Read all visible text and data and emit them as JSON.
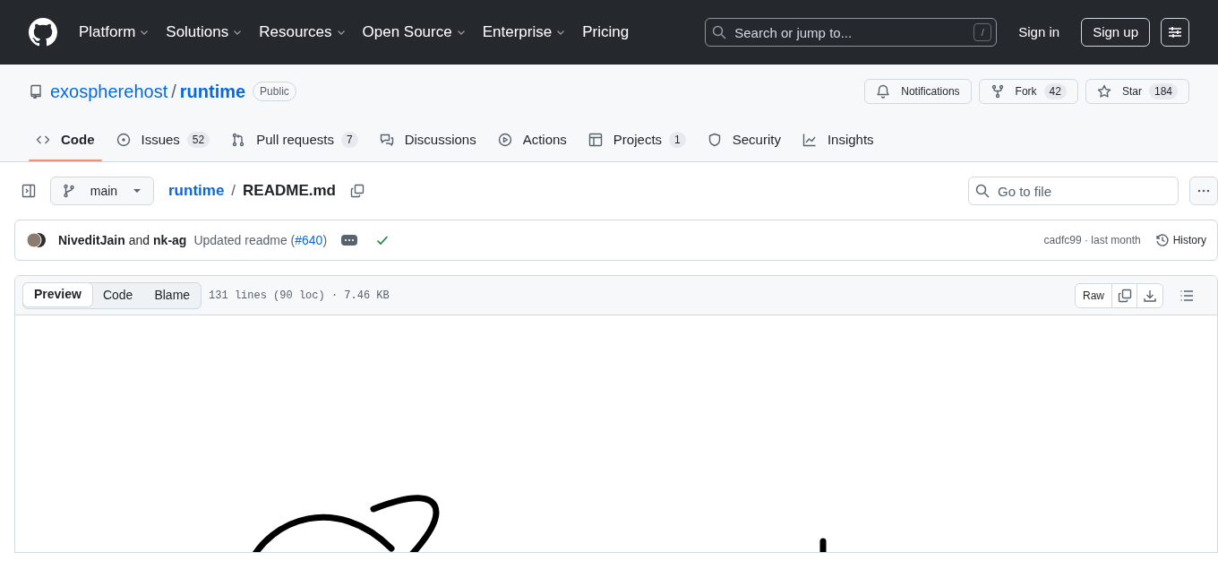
{
  "header": {
    "nav": [
      "Platform",
      "Solutions",
      "Resources",
      "Open Source",
      "Enterprise",
      "Pricing"
    ],
    "search": {
      "placeholder": "Search or jump to...",
      "key": "/"
    },
    "sign_in": "Sign in",
    "sign_up": "Sign up"
  },
  "repo": {
    "owner": "exospherehost",
    "separator": "/",
    "name": "runtime",
    "visibility": "Public",
    "actions": [
      {
        "kind": "notifications",
        "label": "Notifications"
      },
      {
        "kind": "fork",
        "label": "Fork",
        "count": "42"
      },
      {
        "kind": "star",
        "label": "Star",
        "count": "184"
      }
    ]
  },
  "tabs": [
    {
      "kind": "code",
      "label": "Code",
      "selected": true
    },
    {
      "kind": "issues",
      "label": "Issues",
      "count": "52",
      "selected": false
    },
    {
      "kind": "pulls",
      "label": "Pull requests",
      "count": "7",
      "selected": false
    },
    {
      "kind": "discussions",
      "label": "Discussions",
      "selected": false
    },
    {
      "kind": "actions",
      "label": "Actions",
      "selected": false
    },
    {
      "kind": "projects",
      "label": "Projects",
      "count": "1",
      "selected": false
    },
    {
      "kind": "security",
      "label": "Security",
      "selected": false
    },
    {
      "kind": "insights",
      "label": "Insights",
      "selected": false
    }
  ],
  "file_bar": {
    "branch": "main",
    "path_repo": "runtime",
    "path_sep": "/",
    "file": "README.md",
    "go_to_file": {
      "placeholder": "Go to file"
    }
  },
  "commit": {
    "author1": "NiveditJain",
    "and": "and",
    "author2": "nk-ag",
    "message": "Updated readme (",
    "pr": "#640",
    "message_end": ")",
    "sha_time": "cadfc99 · last month",
    "history": "History"
  },
  "file_view": {
    "modes": [
      {
        "label": "Preview",
        "selected": true
      },
      {
        "label": "Code",
        "selected": false
      },
      {
        "label": "Blame",
        "selected": false
      }
    ],
    "info": "131 lines (90 loc) · 7.46 KB",
    "raw": "Raw"
  }
}
